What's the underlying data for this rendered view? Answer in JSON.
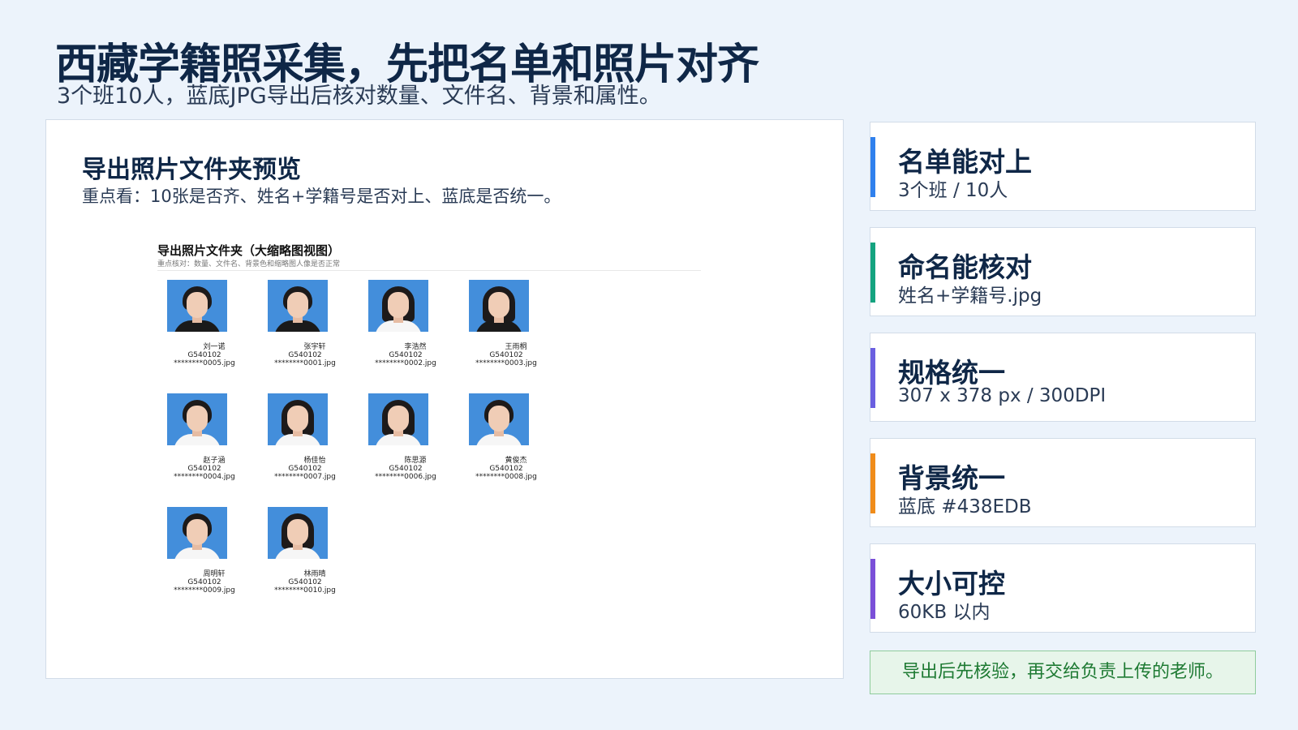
{
  "title": "西藏学籍照采集，先把名单和照片对齐",
  "subtitle": "3个班10人，蓝底JPG导出后核对数量、文件名、背景和属性。",
  "preview": {
    "title": "导出照片文件夹预览",
    "desc": "重点看：10张是否齐、姓名+学籍号是否对上、蓝底是否统一。",
    "folder_title": "导出照片文件夹（大缩略图视图）",
    "folder_hint": "重点核对：数量、文件名、背景色和缩略图人像是否正常",
    "photos": [
      {
        "name": "刘一诺",
        "code": "G540102",
        "file": "********0005.jpg"
      },
      {
        "name": "张宇轩",
        "code": "G540102",
        "file": "********0001.jpg"
      },
      {
        "name": "李浩然",
        "code": "G540102",
        "file": "********0002.jpg"
      },
      {
        "name": "王雨桐",
        "code": "G540102",
        "file": "********0003.jpg"
      },
      {
        "name": "赵子涵",
        "code": "G540102",
        "file": "********0004.jpg"
      },
      {
        "name": "杨佳怡",
        "code": "G540102",
        "file": "********0007.jpg"
      },
      {
        "name": "陈思源",
        "code": "G540102",
        "file": "********0006.jpg"
      },
      {
        "name": "黄俊杰",
        "code": "G540102",
        "file": "********0008.jpg"
      },
      {
        "name": "周明轩",
        "code": "G540102",
        "file": "********0009.jpg"
      },
      {
        "name": "林雨晴",
        "code": "G540102",
        "file": "********0010.jpg"
      }
    ],
    "photo_bg_color": "#438EDB"
  },
  "cards": [
    {
      "title": "名单能对上",
      "value": "3个班 / 10人",
      "accent": "#2f80ed"
    },
    {
      "title": "命名能核对",
      "value": "姓名+学籍号.jpg",
      "accent": "#14a37f"
    },
    {
      "title": "规格统一",
      "value": "307 x 378 px / 300DPI",
      "accent": "#6a5fe0"
    },
    {
      "title": "背景统一",
      "value": "蓝底  #438EDB",
      "accent": "#f08c1a"
    },
    {
      "title": "大小可控",
      "value": "60KB 以内",
      "accent": "#7a4fd8"
    }
  ],
  "footer_note": "导出后先核验，再交给负责上传的老师。"
}
